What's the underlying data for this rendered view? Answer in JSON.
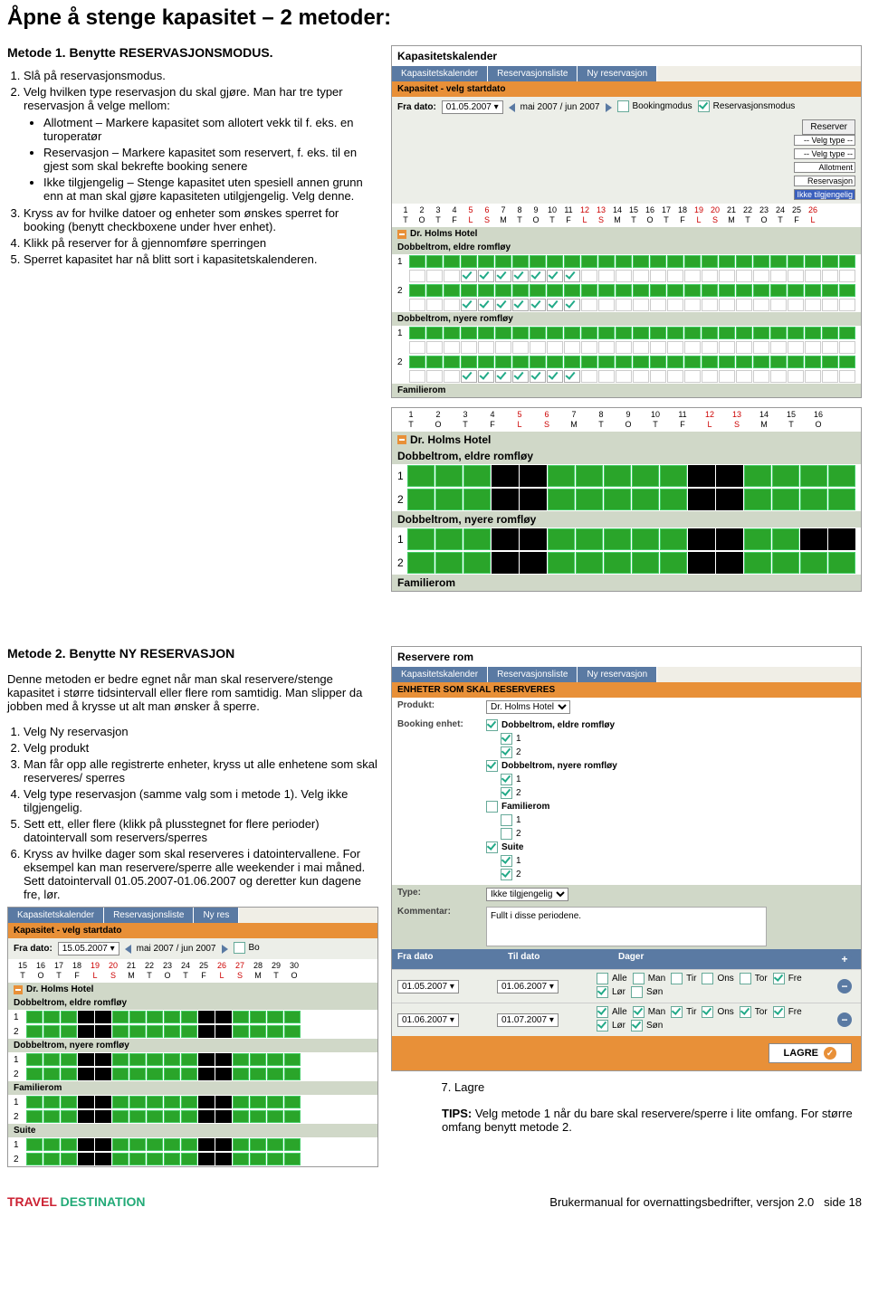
{
  "page_title": "Åpne å stenge kapasitet – 2 metoder:",
  "method1": {
    "heading": "Metode 1. Benytte RESERVASJONSMODUS.",
    "steps": {
      "s1": "Slå på reservasjonsmodus.",
      "s2": "Velg hvilken type reservasjon du skal gjøre. Man har tre typer reservasjon å velge mellom:",
      "b1": "Allotment – Markere kapasitet som allotert vekk til f. eks. en turoperatør",
      "b2": "Reservasjon – Markere kapasitet som reservert, f. eks. til en gjest som skal bekrefte booking senere",
      "b3": "Ikke tilgjengelig – Stenge kapasitet uten spesiell annen grunn enn at man skal gjøre kapasiteten utilgjengelig. Velg denne.",
      "s3": "Kryss av for hvilke datoer og enheter som ønskes sperret for booking (benytt checkboxene under hver enhet).",
      "s4": "Klikk på reserver for å gjennomføre sperringen",
      "s5": "Sperret kapasitet har nå blitt sort i kapasitetskalenderen."
    }
  },
  "method2": {
    "heading": "Metode 2. Benytte NY RESERVASJON",
    "intro": "Denne metoden er bedre egnet når man skal reservere/stenge kapasitet i større tidsintervall eller flere rom samtidig. Man slipper da jobben med å krysse ut alt man ønsker å sperre.",
    "steps": {
      "s1": "Velg Ny reservasjon",
      "s2": "Velg produkt",
      "s3": "Man får opp alle registrerte enheter, kryss ut alle enhetene som skal reserveres/ sperres",
      "s4": "Velg type reservasjon (samme valg som i metode 1). Velg ikke tilgjengelig.",
      "s5": "Sett ett, eller flere (klikk på plusstegnet for flere perioder) datointervall som reservers/sperres",
      "s6": "Kryss av hvilke dager som skal reserveres i datointervallene. For eksempel kan man reservere/sperre alle weekender i mai måned. Sett datointervall 01.05.2007-01.06.2007 og deretter kun dagene fre, lør.",
      "s7": "Lagre"
    },
    "tips_label": "TIPS:",
    "tips": " Velg metode 1 når du bare skal reservere/sperre i lite omfang. For større omfang benytt metode 2."
  },
  "screenshots": {
    "kap1": {
      "title": "Kapasitetskalender",
      "tabs": [
        "Kapasitetskalender",
        "Reservasjonsliste",
        "Ny reservasjon"
      ],
      "subbar": "Kapasitet - velg startdato",
      "fra_dato_label": "Fra dato:",
      "fra_dato_value": "01.05.2007",
      "period": "mai 2007 / jun 2007",
      "mode_booking": "Bookingmodus",
      "mode_res": "Reservasjonsmodus",
      "reserver": "Reserver",
      "velg_type": "-- Velg type --",
      "options": [
        "-- Velg type --",
        "Allotment",
        "Reservasjon",
        "Ikke tilgjengelig"
      ],
      "days": [
        {
          "n": "1",
          "d": "T"
        },
        {
          "n": "2",
          "d": "O"
        },
        {
          "n": "3",
          "d": "T"
        },
        {
          "n": "4",
          "d": "F"
        },
        {
          "n": "5",
          "d": "L",
          "r": 1
        },
        {
          "n": "6",
          "d": "S",
          "r": 1
        },
        {
          "n": "7",
          "d": "M"
        },
        {
          "n": "8",
          "d": "T"
        },
        {
          "n": "9",
          "d": "O"
        },
        {
          "n": "10",
          "d": "T"
        },
        {
          "n": "11",
          "d": "F"
        },
        {
          "n": "12",
          "d": "L",
          "r": 1
        },
        {
          "n": "13",
          "d": "S",
          "r": 1
        },
        {
          "n": "14",
          "d": "M"
        },
        {
          "n": "15",
          "d": "T"
        },
        {
          "n": "16",
          "d": "O"
        },
        {
          "n": "17",
          "d": "T"
        },
        {
          "n": "18",
          "d": "F"
        },
        {
          "n": "19",
          "d": "L",
          "r": 1
        },
        {
          "n": "20",
          "d": "S",
          "r": 1
        },
        {
          "n": "21",
          "d": "M"
        },
        {
          "n": "22",
          "d": "T"
        },
        {
          "n": "23",
          "d": "O"
        },
        {
          "n": "24",
          "d": "T"
        },
        {
          "n": "25",
          "d": "F"
        },
        {
          "n": "26",
          "d": "L",
          "r": 1
        }
      ],
      "hotel": "Dr. Holms Hotel",
      "room1": "Dobbeltrom, eldre romfløy",
      "room2": "Dobbeltrom, nyere romfløy",
      "room3": "Familierom"
    },
    "kap2": {
      "days": [
        {
          "n": "1",
          "d": "T"
        },
        {
          "n": "2",
          "d": "O"
        },
        {
          "n": "3",
          "d": "T"
        },
        {
          "n": "4",
          "d": "F"
        },
        {
          "n": "5",
          "d": "L",
          "r": 1
        },
        {
          "n": "6",
          "d": "S",
          "r": 1
        },
        {
          "n": "7",
          "d": "M"
        },
        {
          "n": "8",
          "d": "T"
        },
        {
          "n": "9",
          "d": "O"
        },
        {
          "n": "10",
          "d": "T"
        },
        {
          "n": "11",
          "d": "F"
        },
        {
          "n": "12",
          "d": "L",
          "r": 1
        },
        {
          "n": "13",
          "d": "S",
          "r": 1
        },
        {
          "n": "14",
          "d": "M"
        },
        {
          "n": "15",
          "d": "T"
        },
        {
          "n": "16",
          "d": "O"
        }
      ],
      "hotel": "Dr. Holms Hotel",
      "room1": "Dobbeltrom, eldre romfløy",
      "room2": "Dobbeltrom, nyere romfløy",
      "room3": "Familierom"
    },
    "reservere": {
      "title": "Reservere rom",
      "tabs": [
        "Kapasitetskalender",
        "Reservasjonsliste",
        "Ny reservasjon"
      ],
      "subbar": "ENHETER SOM SKAL RESERVERES",
      "produkt_label": "Produkt:",
      "produkt_value": "Dr. Holms Hotel",
      "booking_enhet": "Booking enhet:",
      "groups": [
        {
          "name": "Dobbeltrom, eldre romfløy",
          "on": true,
          "units": [
            {
              "n": "1",
              "on": true
            },
            {
              "n": "2",
              "on": true
            }
          ]
        },
        {
          "name": "Dobbeltrom, nyere romfløy",
          "on": true,
          "units": [
            {
              "n": "1",
              "on": true
            },
            {
              "n": "2",
              "on": true
            }
          ]
        },
        {
          "name": "Familierom",
          "on": false,
          "units": [
            {
              "n": "1",
              "on": false
            },
            {
              "n": "2",
              "on": false
            }
          ]
        },
        {
          "name": "Suite",
          "on": true,
          "units": [
            {
              "n": "1",
              "on": true
            },
            {
              "n": "2",
              "on": true
            }
          ]
        }
      ],
      "type_label": "Type:",
      "type_value": "Ikke tilgjengelig",
      "kommentar_label": "Kommentar:",
      "kommentar_value": "Fullt i disse periodene.",
      "cols": {
        "fra": "Fra dato",
        "til": "Til dato",
        "dager": "Dager"
      },
      "rows": [
        {
          "fra": "01.05.2007",
          "til": "01.06.2007",
          "days": {
            "alle": false,
            "man": false,
            "tir": false,
            "ons": false,
            "tor": false,
            "fre": true,
            "lor": true,
            "son": false
          }
        },
        {
          "fra": "01.06.2007",
          "til": "01.07.2007",
          "days": {
            "alle": true,
            "man": true,
            "tir": true,
            "ons": true,
            "tor": true,
            "fre": true,
            "lor": true,
            "son": true
          }
        }
      ],
      "daylabels": [
        "Alle",
        "Man",
        "Tir",
        "Ons",
        "Tor",
        "Fre",
        "Lør",
        "Søn"
      ],
      "lagre": "LAGRE"
    },
    "kap3": {
      "tabs": [
        "Kapasitetskalender",
        "Reservasjonsliste",
        "Ny res"
      ],
      "subbar": "Kapasitet - velg startdato",
      "fra_dato_label": "Fra dato:",
      "fra_dato_value": "15.05.2007",
      "period": "mai 2007 / jun 2007",
      "bo": "Bo",
      "days": [
        {
          "n": "15",
          "d": "T"
        },
        {
          "n": "16",
          "d": "O"
        },
        {
          "n": "17",
          "d": "T"
        },
        {
          "n": "18",
          "d": "F"
        },
        {
          "n": "19",
          "d": "L",
          "r": 1
        },
        {
          "n": "20",
          "d": "S",
          "r": 1
        },
        {
          "n": "21",
          "d": "M"
        },
        {
          "n": "22",
          "d": "T"
        },
        {
          "n": "23",
          "d": "O"
        },
        {
          "n": "24",
          "d": "T"
        },
        {
          "n": "25",
          "d": "F"
        },
        {
          "n": "26",
          "d": "L",
          "r": 1
        },
        {
          "n": "27",
          "d": "S",
          "r": 1
        },
        {
          "n": "28",
          "d": "M"
        },
        {
          "n": "29",
          "d": "T"
        },
        {
          "n": "30",
          "d": "O"
        }
      ],
      "hotel": "Dr. Holms Hotel",
      "room1": "Dobbeltrom, eldre romfløy",
      "room2": "Dobbeltrom, nyere romfløy",
      "room3": "Familierom",
      "room4": "Suite"
    }
  },
  "footer": {
    "logo1": "TRAVEL",
    "logo2": "DESTINATION",
    "text": "Brukermanual for overnattingsbedrifter, versjon 2.0",
    "page": "side 18"
  }
}
